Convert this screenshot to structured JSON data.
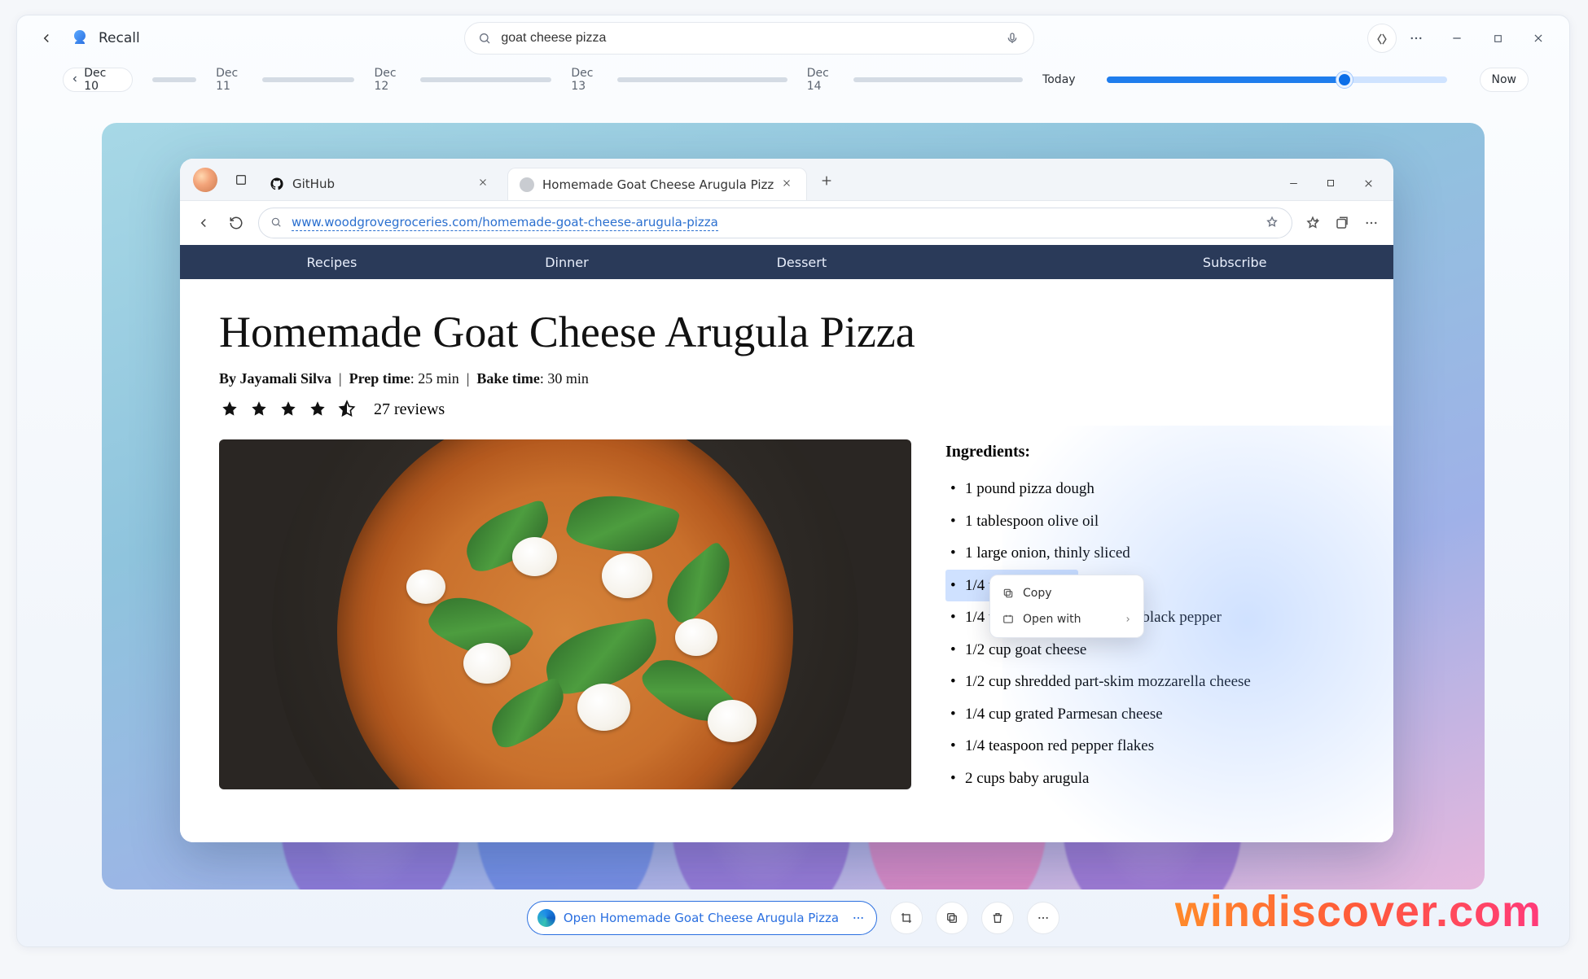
{
  "app": {
    "name": "Recall",
    "search_value": "goat cheese pizza"
  },
  "timeline": {
    "selected": "Dec 10",
    "dates": [
      "Dec 11",
      "Dec 12",
      "Dec 13",
      "Dec 14"
    ],
    "today_label": "Today",
    "now_label": "Now"
  },
  "browser": {
    "tabs": [
      {
        "label": "GitHub"
      },
      {
        "label": "Homemade Goat Cheese Arugula Pizz"
      }
    ],
    "url": "www.woodgrovegroceries.com/homemade-goat-cheese-arugula-pizza",
    "site_nav": [
      "Recipes",
      "Dinner",
      "Dessert",
      "",
      "Subscribe"
    ]
  },
  "recipe": {
    "title": "Homemade Goat Cheese Arugula Pizza",
    "meta_author_label": "By",
    "meta_author": "Jayamali Silva",
    "meta_prep_label": "Prep time",
    "meta_prep": "25 min",
    "meta_bake_label": "Bake time",
    "meta_bake": "30 min",
    "reviews": "27 reviews",
    "ingredients_heading": "Ingredients:",
    "ingredients": [
      "1 pound pizza dough",
      "1 tablespoon olive oil",
      "1 large onion, thinly sliced",
      "1/4 teaspoon salt",
      "1/4 teaspoon freshly ground black pepper",
      "1/2 cup goat cheese",
      "1/2 cup shredded part-skim mozzarella cheese",
      "1/4 cup grated Parmesan cheese",
      "1/4 teaspoon red pepper flakes",
      "2 cups baby arugula"
    ],
    "selected_index": 3
  },
  "context_menu": {
    "copy": "Copy",
    "open_with": "Open with"
  },
  "bottom": {
    "open_label": "Open Homemade Goat Cheese Arugula Pizza"
  },
  "watermark": "windiscover.com"
}
